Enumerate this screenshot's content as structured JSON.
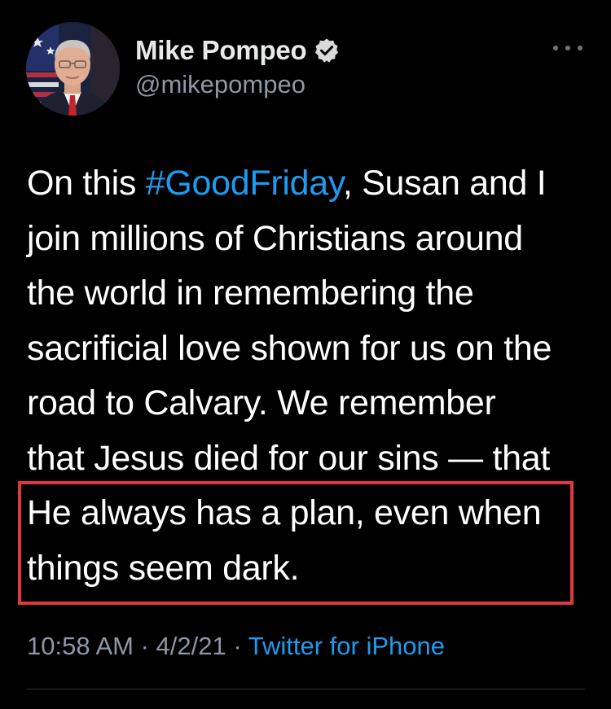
{
  "author": {
    "display_name": "Mike Pompeo",
    "handle": "@mikepompeo",
    "verified": true,
    "avatar_icon": "profile-photo"
  },
  "more_icon": "more-horizontal-icon",
  "tweet": {
    "lines": [
      {
        "before": "On this ",
        "hashtag": "#GoodFriday",
        "after": ", Susan and I"
      },
      {
        "text": "join millions of Christians around"
      },
      {
        "text": "the world in remembering the"
      },
      {
        "text": "sacrificial love shown for us on the"
      },
      {
        "text": "road to Calvary. We remember"
      },
      {
        "text": "that Jesus died for our sins — that"
      },
      {
        "text": "He always has a plan, even when"
      },
      {
        "text": "things seem dark."
      }
    ]
  },
  "meta": {
    "time": "10:58 AM",
    "separator": " · ",
    "date": "4/2/21",
    "source": "Twitter for iPhone"
  },
  "colors": {
    "background": "#000000",
    "text": "#ffffff",
    "secondary": "#8b98a5",
    "link": "#1d9bf0",
    "highlight": "#e0383e"
  }
}
